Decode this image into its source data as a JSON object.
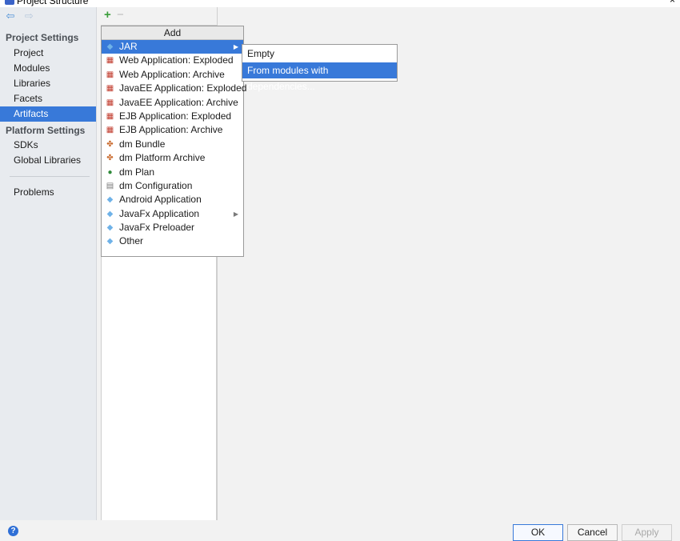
{
  "window": {
    "title": "Project Structure",
    "close_glyph": "×"
  },
  "nav": {
    "back_icon": "arrow-left-icon",
    "forward_icon": "arrow-right-icon",
    "sections": [
      {
        "title": "Project Settings",
        "items": [
          "Project",
          "Modules",
          "Libraries",
          "Facets",
          "Artifacts"
        ]
      },
      {
        "title": "Platform Settings",
        "items": [
          "SDKs",
          "Global Libraries"
        ]
      }
    ],
    "extra_items": [
      "Problems"
    ],
    "selected": "Artifacts"
  },
  "toolbar": {
    "add_glyph": "+",
    "remove_glyph": "−"
  },
  "popup": {
    "header": "Add",
    "items": [
      {
        "label": "JAR",
        "icon": "jar-icon",
        "submenu": true,
        "selected": true
      },
      {
        "label": "Web Application: Exploded",
        "icon": "web-app-icon"
      },
      {
        "label": "Web Application: Archive",
        "icon": "web-app-icon"
      },
      {
        "label": "JavaEE Application: Exploded",
        "icon": "javaee-icon"
      },
      {
        "label": "JavaEE Application: Archive",
        "icon": "javaee-icon"
      },
      {
        "label": "EJB Application: Exploded",
        "icon": "ejb-icon"
      },
      {
        "label": "EJB Application: Archive",
        "icon": "ejb-icon"
      },
      {
        "label": "dm Bundle",
        "icon": "dm-bundle-icon"
      },
      {
        "label": "dm Platform Archive",
        "icon": "dm-platform-icon"
      },
      {
        "label": "dm Plan",
        "icon": "dm-plan-icon"
      },
      {
        "label": "dm Configuration",
        "icon": "dm-config-icon"
      },
      {
        "label": "Android Application",
        "icon": "android-icon"
      },
      {
        "label": "JavaFx Application",
        "icon": "javafx-icon",
        "submenu": true
      },
      {
        "label": "JavaFx Preloader",
        "icon": "javafx-icon"
      },
      {
        "label": "Other",
        "icon": "other-icon"
      }
    ]
  },
  "submenu": {
    "items": [
      "Empty",
      "From modules with dependencies..."
    ],
    "selected": "From modules with dependencies..."
  },
  "footer": {
    "help_glyph": "?",
    "ok_label": "OK",
    "cancel_label": "Cancel",
    "apply_label": "Apply"
  },
  "colors": {
    "selection": "#3879d9",
    "nav_bg": "#e8ebef",
    "add_green": "#3a9e3a"
  }
}
